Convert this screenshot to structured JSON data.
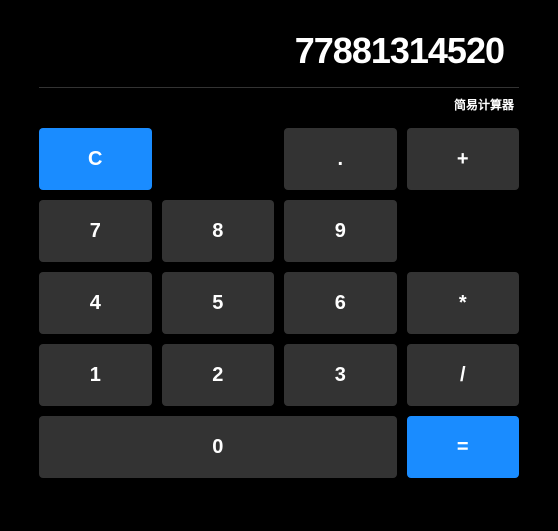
{
  "display": "77881314520",
  "subtitle": "简易计算器",
  "buttons": {
    "clear": "C",
    "dot": ".",
    "plus": "+",
    "seven": "7",
    "eight": "8",
    "nine": "9",
    "four": "4",
    "five": "5",
    "six": "6",
    "multiply": "*",
    "one": "1",
    "two": "2",
    "three": "3",
    "divide": "/",
    "zero": "0",
    "equals": "="
  },
  "colors": {
    "background": "#000000",
    "button": "#333333",
    "accent": "#1a8cff",
    "text": "#ffffff"
  }
}
